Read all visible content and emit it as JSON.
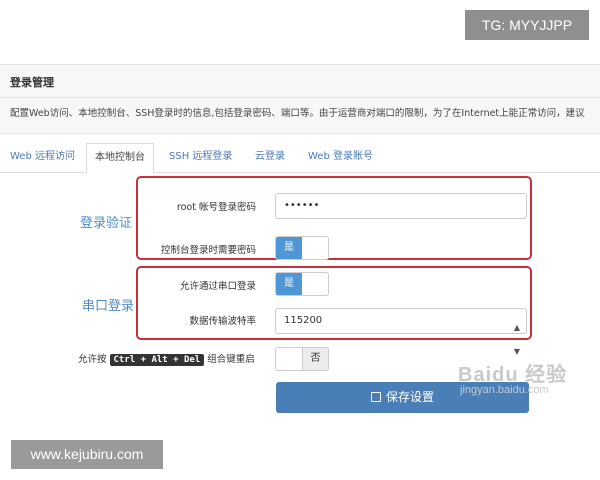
{
  "watermarks": {
    "top": "TG: MYYJJPP",
    "bottom": "www.kejubiru.com",
    "baidu_logo": "Baidu 经验",
    "baidu_url": "jingyan.baidu.com"
  },
  "panel": {
    "title": "登录管理",
    "description": "配置Web访问、本地控制台、SSH登录时的信息,包括登录密码、端口等。由于运营商对端口的限制，为了在Internet上能正常访问，建议"
  },
  "tabs": [
    {
      "label": "Web 远程访问",
      "active": false
    },
    {
      "label": "本地控制台",
      "active": true
    },
    {
      "label": "SSH 远程登录",
      "active": false
    },
    {
      "label": "云登录",
      "active": false
    },
    {
      "label": "Web 登录账号",
      "active": false
    }
  ],
  "sections": {
    "auth": "登录验证",
    "serial": "串口登录"
  },
  "fields": {
    "root_password": {
      "label": "root 帐号登录密码",
      "value": "••••••"
    },
    "console_requires_password": {
      "label": "控制台登录时需要密码",
      "on_label": "是",
      "state": "on"
    },
    "allow_serial_login": {
      "label": "允许通过串口登录",
      "on_label": "是",
      "state": "on"
    },
    "baud_rate": {
      "label": "数据传输波特率",
      "value": "115200"
    },
    "ctrl_alt_del": {
      "prefix": "允许按",
      "keys": "Ctrl + Alt + Del",
      "suffix": "组合键重启",
      "off_label": "否",
      "state": "off"
    }
  },
  "save_button": {
    "label": "保存设置"
  },
  "colors": {
    "accent": "#4a7eb7",
    "section_label": "#4f8cc9",
    "highlight_box": "#c8303a",
    "toggle_on": "#4f96d6"
  }
}
